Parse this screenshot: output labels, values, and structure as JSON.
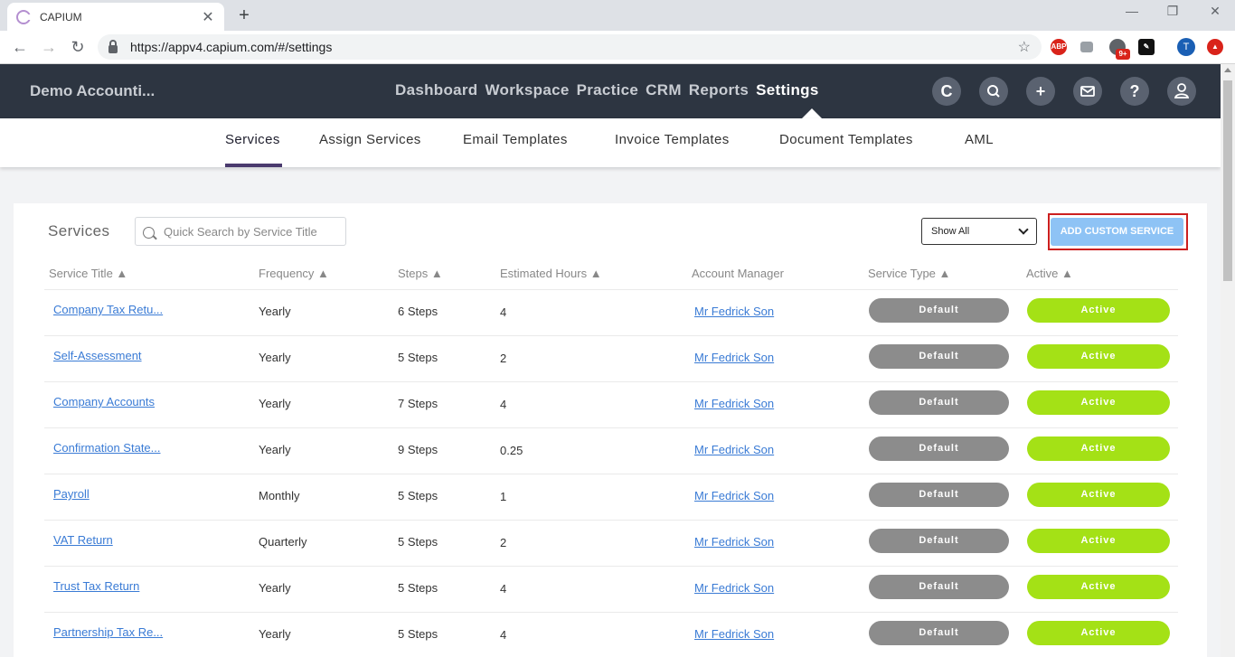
{
  "browser": {
    "tab_title": "CAPIUM",
    "url": "https://appv4.capium.com/#/settings",
    "profile_initial": "T",
    "ext_abp": "ABP",
    "ext_badge": "9+"
  },
  "header": {
    "org_name": "Demo Accounti...",
    "nav": [
      "Dashboard",
      "Workspace",
      "Practice",
      "CRM",
      "Reports",
      "Settings"
    ],
    "active_nav": "Settings"
  },
  "subnav": {
    "items": [
      "Services",
      "Assign Services",
      "Email Templates",
      "Invoice Templates",
      "Document Templates",
      "AML"
    ],
    "active": "Services"
  },
  "services": {
    "title": "Services",
    "search_placeholder": "Quick Search by Service Title",
    "filter_selected": "Show All",
    "add_button": "ADD CUSTOM SERVICE",
    "columns": [
      "Service Title ▲",
      "Frequency ▲",
      "Steps ▲",
      "Estimated Hours ▲",
      "Account Manager",
      "Service Type ▲",
      "Active ▲"
    ],
    "rows": [
      {
        "title": "Company Tax Retu...",
        "frequency": "Yearly",
        "steps": "6 Steps",
        "hours": "4",
        "manager": "Mr Fedrick Son",
        "type": "Default",
        "status": "Active"
      },
      {
        "title": "Self-Assessment",
        "frequency": "Yearly",
        "steps": "5 Steps",
        "hours": "2",
        "manager": "Mr Fedrick Son",
        "type": "Default",
        "status": "Active"
      },
      {
        "title": "Company Accounts",
        "frequency": "Yearly",
        "steps": "7 Steps",
        "hours": "4",
        "manager": "Mr Fedrick Son",
        "type": "Default",
        "status": "Active"
      },
      {
        "title": "Confirmation State...",
        "frequency": "Yearly",
        "steps": "9 Steps",
        "hours": "0.25",
        "manager": "Mr Fedrick Son",
        "type": "Default",
        "status": "Active"
      },
      {
        "title": "Payroll",
        "frequency": "Monthly",
        "steps": "5 Steps",
        "hours": "1",
        "manager": "Mr Fedrick Son",
        "type": "Default",
        "status": "Active"
      },
      {
        "title": "VAT Return",
        "frequency": "Quarterly",
        "steps": "5 Steps",
        "hours": "2",
        "manager": "Mr Fedrick Son",
        "type": "Default",
        "status": "Active"
      },
      {
        "title": "Trust Tax Return",
        "frequency": "Yearly",
        "steps": "5 Steps",
        "hours": "4",
        "manager": "Mr Fedrick Son",
        "type": "Default",
        "status": "Active"
      },
      {
        "title": "Partnership Tax Re...",
        "frequency": "Yearly",
        "steps": "5 Steps",
        "hours": "4",
        "manager": "Mr Fedrick Son",
        "type": "Default",
        "status": "Active"
      }
    ]
  },
  "colors": {
    "header_bg": "#2d3541",
    "active_pill": "#a4e116",
    "default_pill": "#8c8c8c",
    "link": "#3a7bd5",
    "add_button": "#8ec3f5",
    "highlight_outline": "#cc1f1f"
  },
  "icons": {
    "header": [
      "capium-logo-icon",
      "search-icon",
      "plus-icon",
      "mail-icon",
      "help-icon",
      "user-icon"
    ]
  }
}
